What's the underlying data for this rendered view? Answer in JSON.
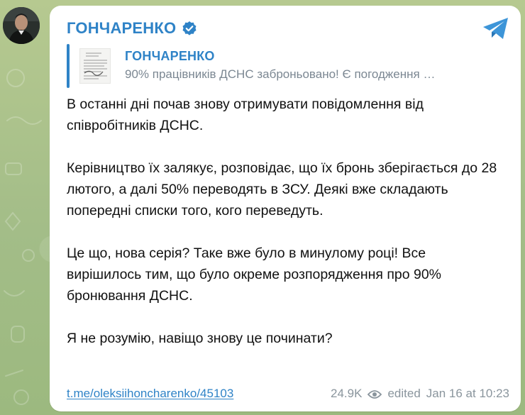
{
  "post": {
    "channel_name": "ГОНЧАРЕНКО",
    "reply": {
      "title": "ГОНЧАРЕНКО",
      "preview": "90% працівників ДСНС заброньовано! Є погодження …"
    },
    "paragraphs": [
      "В останні дні почав знову отримувати повідомлення від співробітників ДСНС.",
      "Керівництво їх залякує, розповідає, що їх бронь зберігається до 28 лютого, а далі 50% переводять в ЗСУ. Деякі вже складають попередні списки того, кого переведуть.",
      "Це що, нова серія? Таке вже було в минулому році! Все вирішилось тим, що було окреме розпорядження про 90% бронювання ДСНС.",
      "Я не розумію, навіщо знову це починати?"
    ],
    "link": "t.me/oleksiihoncharenko/45103",
    "views": "24.9K",
    "edited_label": "edited",
    "timestamp": "Jan 16 at 10:23"
  },
  "icons": {
    "verified": "verified-badge-icon",
    "share": "telegram-share-icon",
    "views": "eye-icon"
  },
  "colors": {
    "accent": "#2f83c7",
    "bubble_bg": "#ffffff",
    "meta_text": "#8a959d",
    "reply_text": "#7b8792",
    "wallpaper": "#a9c18a"
  }
}
